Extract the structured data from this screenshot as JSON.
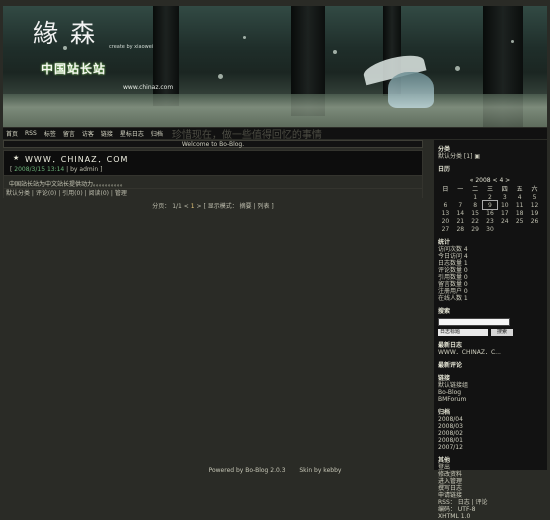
{
  "banner": {
    "logo_text": "緣 森",
    "logo_sub": "create by xiaowei",
    "site_cn": "中国站长站",
    "site_url": "www.chinaz.com"
  },
  "nav": {
    "items": [
      "首页",
      "RSS",
      "标签",
      "留言",
      "访客",
      "链接",
      "星标日志",
      "归档"
    ],
    "marquee": "珍惜现在，做一些值得回忆的事情"
  },
  "main": {
    "welcome": "Welcome to Bo-Blog.",
    "post": {
      "star": "★",
      "title": "WWW．CHINAZ．COM",
      "meta_prefix": "[",
      "time": "2008/3/15 13:14",
      "meta_sep": "|",
      "author_prefix": "by",
      "author": "admin",
      "meta_suffix": "]",
      "content": "中国站长站为中文站长提供动力。。。。。。。。。。",
      "footer": "默认分类 | 评论(0) | 引用(0) | 阅读(0) | 管理"
    },
    "pager": {
      "label": "分页：",
      "page": "1/1",
      "first": "<",
      "current": "1",
      "last": ">",
      "mode": "[ 显示模式： 摘要 | 列表 ]"
    }
  },
  "sidebar": {
    "category": {
      "title": "分类",
      "item": "默认分类 [1] ▣"
    },
    "calendar": {
      "title": "日历",
      "header": "« 2008 < 4 >",
      "week": [
        "日",
        "一",
        "二",
        "三",
        "四",
        "五",
        "六"
      ],
      "rows": [
        [
          "",
          "",
          "1",
          "2",
          "3",
          "4",
          "5"
        ],
        [
          "6",
          "7",
          "8",
          "9",
          "10",
          "11",
          "12"
        ],
        [
          "13",
          "14",
          "15",
          "16",
          "17",
          "18",
          "19"
        ],
        [
          "20",
          "21",
          "22",
          "23",
          "24",
          "25",
          "26"
        ],
        [
          "27",
          "28",
          "29",
          "30",
          "",
          "",
          ""
        ]
      ]
    },
    "stats": {
      "title": "统计",
      "lines": [
        "访问次数  4",
        "今日访问  4",
        "日志数量  1",
        "评论数量  0",
        "引用数量  0",
        "留言数量  0",
        "注册用户  0",
        "在线人数  1"
      ]
    },
    "search": {
      "title": "搜索",
      "select": "日志标题",
      "button": "搜索"
    },
    "latest_posts": {
      "title": "最新日志",
      "item": "WWW．CHINAZ．C..."
    },
    "latest_comments": {
      "title": "最新评论"
    },
    "links": {
      "title": "链接",
      "items": [
        "默认链接组",
        "Bo-Blog",
        "BMForum"
      ]
    },
    "archive": {
      "title": "归档",
      "items": [
        "2008/04",
        "2008/03",
        "2008/02",
        "2008/01",
        "2007/12"
      ]
    },
    "other": {
      "title": "其他",
      "items": [
        "登出",
        "修改资料",
        "进入管理",
        "撰写日志",
        "申请链接",
        "RSS： 日志 | 评论",
        "编码： UTF-8",
        "XHTML 1.0"
      ]
    }
  },
  "footer": {
    "powered": "Powered by Bo-Blog 2.0.3",
    "skin": "Skin by kebby"
  }
}
